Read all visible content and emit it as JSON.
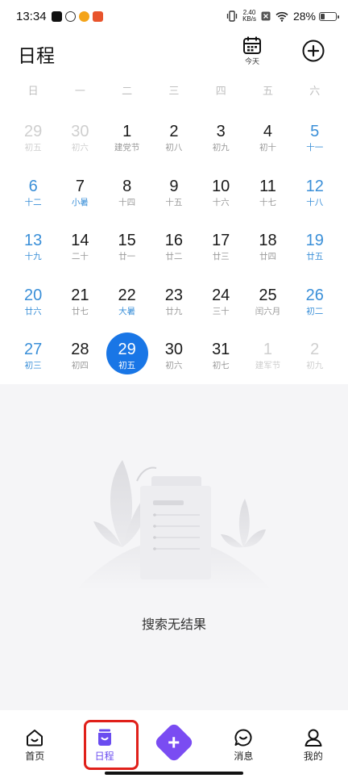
{
  "status_bar": {
    "time": "13:34",
    "net_speed_value": "2.40",
    "net_speed_unit": "KB/s",
    "battery": "28%",
    "battery_level": 0.28
  },
  "header": {
    "title": "日程",
    "today_label": "今天"
  },
  "calendar": {
    "weekdays": [
      "日",
      "一",
      "二",
      "三",
      "四",
      "五",
      "六"
    ],
    "weeks": [
      [
        {
          "num": "29",
          "sub": "初五",
          "outside": true
        },
        {
          "num": "30",
          "sub": "初六",
          "outside": true
        },
        {
          "num": "1",
          "sub": "建党节"
        },
        {
          "num": "2",
          "sub": "初八"
        },
        {
          "num": "3",
          "sub": "初九"
        },
        {
          "num": "4",
          "sub": "初十"
        },
        {
          "num": "5",
          "sub": "十一",
          "weekend": true
        }
      ],
      [
        {
          "num": "6",
          "sub": "十二",
          "weekend": true
        },
        {
          "num": "7",
          "sub": "小暑",
          "festival": true
        },
        {
          "num": "8",
          "sub": "十四"
        },
        {
          "num": "9",
          "sub": "十五"
        },
        {
          "num": "10",
          "sub": "十六"
        },
        {
          "num": "11",
          "sub": "十七"
        },
        {
          "num": "12",
          "sub": "十八",
          "weekend": true
        }
      ],
      [
        {
          "num": "13",
          "sub": "十九",
          "weekend": true
        },
        {
          "num": "14",
          "sub": "二十"
        },
        {
          "num": "15",
          "sub": "廿一"
        },
        {
          "num": "16",
          "sub": "廿二"
        },
        {
          "num": "17",
          "sub": "廿三"
        },
        {
          "num": "18",
          "sub": "廿四"
        },
        {
          "num": "19",
          "sub": "廿五",
          "weekend": true
        }
      ],
      [
        {
          "num": "20",
          "sub": "廿六",
          "weekend": true
        },
        {
          "num": "21",
          "sub": "廿七"
        },
        {
          "num": "22",
          "sub": "大暑",
          "festival": true
        },
        {
          "num": "23",
          "sub": "廿九"
        },
        {
          "num": "24",
          "sub": "三十"
        },
        {
          "num": "25",
          "sub": "闰六月"
        },
        {
          "num": "26",
          "sub": "初二",
          "weekend": true
        }
      ],
      [
        {
          "num": "27",
          "sub": "初三",
          "weekend": true
        },
        {
          "num": "28",
          "sub": "初四"
        },
        {
          "num": "29",
          "sub": "初五",
          "selected": true
        },
        {
          "num": "30",
          "sub": "初六"
        },
        {
          "num": "31",
          "sub": "初七"
        },
        {
          "num": "1",
          "sub": "建军节",
          "outside": true
        },
        {
          "num": "2",
          "sub": "初九",
          "outside": true
        }
      ]
    ]
  },
  "empty_state": {
    "text": "搜索无结果"
  },
  "tabbar": {
    "items": [
      {
        "label": "首页",
        "icon": "home-icon"
      },
      {
        "label": "日程",
        "icon": "schedule-icon",
        "active": true
      },
      {
        "label": "",
        "icon": "plus-icon"
      },
      {
        "label": "消息",
        "icon": "message-icon"
      },
      {
        "label": "我的",
        "icon": "profile-icon"
      }
    ]
  },
  "colors": {
    "accent_blue": "#1976e6",
    "weekend_blue": "#3a8fd8",
    "tab_active": "#6a4cf0",
    "highlight_red": "#e0201a"
  }
}
